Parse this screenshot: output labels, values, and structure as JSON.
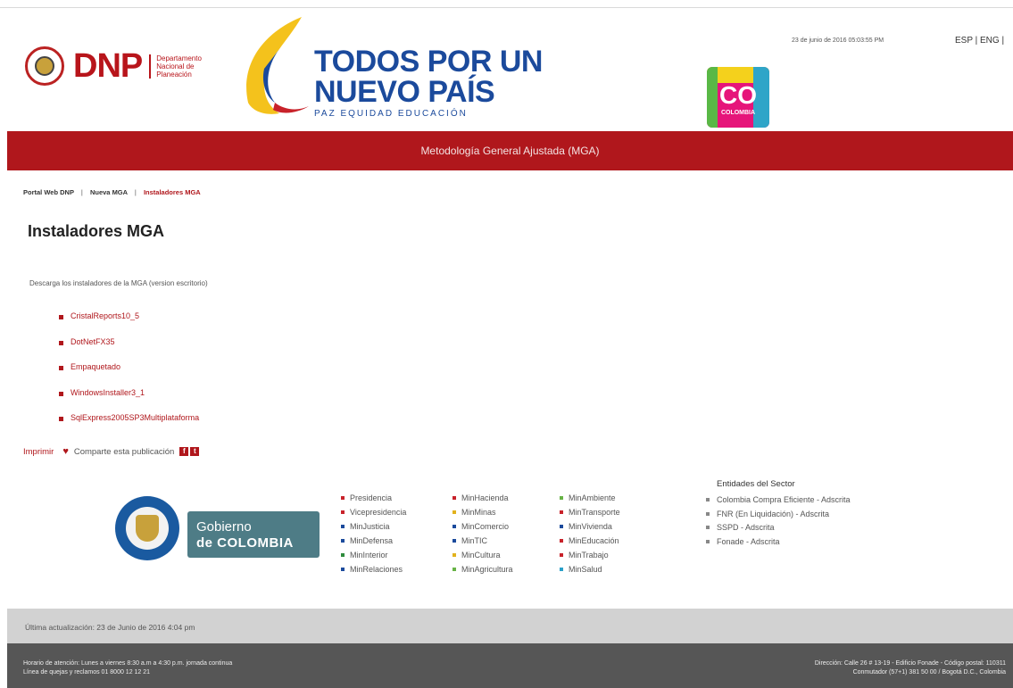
{
  "header": {
    "dnp_logo_text": "DNP",
    "dnp_logo_sub": "Departamento Nacional de Planeación",
    "slogan_line1": "TODOS POR UN",
    "slogan_line2": "NUEVO PAÍS",
    "slogan_line3": "PAZ  EQUIDAD  EDUCACIÓN",
    "colombia_logo_text": "CO",
    "colombia_logo_sub": "COLOMBIA",
    "date": "23 de junio de 2016 05:03:55 PM",
    "lang_esp": "ESP",
    "lang_sep": "|",
    "lang_eng": "ENG",
    "lang_trail": "|"
  },
  "banner": {
    "title": "Metodología General Ajustada (MGA)"
  },
  "breadcrumb": {
    "items": [
      "Portal Web DNP",
      "Nueva MGA",
      "Instaladores MGA"
    ],
    "separator": "|"
  },
  "page": {
    "title": "Instaladores MGA",
    "intro": "Descarga los instaladores de la MGA (version escritorio)",
    "downloads": [
      "CristalReports10_5",
      "DotNetFX35",
      "Empaquetado",
      "WindowsInstaller3_1",
      "SqlExpress2005SP3Multiplataforma"
    ]
  },
  "share": {
    "print_label": "Imprimir",
    "share_label": "Comparte esta publicación",
    "facebook": "f",
    "twitter": "t"
  },
  "gobierno": {
    "line1": "Gobierno",
    "line2": "de COLOMBIA"
  },
  "ministries": [
    {
      "label": "Presidencia",
      "color": "#c8222a"
    },
    {
      "label": "MinHacienda",
      "color": "#c8222a"
    },
    {
      "label": "MinAmbiente",
      "color": "#67b346"
    },
    {
      "label": "Vicepresidencia",
      "color": "#c8222a"
    },
    {
      "label": "MinMinas",
      "color": "#e2b21d"
    },
    {
      "label": "MinTransporte",
      "color": "#c8222a"
    },
    {
      "label": "MinJusticia",
      "color": "#1b4a9c"
    },
    {
      "label": "MinComercio",
      "color": "#1b4a9c"
    },
    {
      "label": "MinVivienda",
      "color": "#1b4a9c"
    },
    {
      "label": "MinDefensa",
      "color": "#1b4a9c"
    },
    {
      "label": "MinTIC",
      "color": "#1b4a9c"
    },
    {
      "label": "MinEducación",
      "color": "#c8222a"
    },
    {
      "label": "MinInterior",
      "color": "#2e8b3d"
    },
    {
      "label": "MinCultura",
      "color": "#e2b21d"
    },
    {
      "label": "MinTrabajo",
      "color": "#c8222a"
    },
    {
      "label": "MinRelaciones",
      "color": "#1b4a9c"
    },
    {
      "label": "MinAgricultura",
      "color": "#67b346"
    },
    {
      "label": "MinSalud",
      "color": "#2aa0c8"
    }
  ],
  "sector": {
    "title": "Entidades del Sector",
    "items": [
      "Colombia Compra Eficiente - Adscrita",
      "FNR (En Liquidación) - Adscrita",
      "SSPD - Adscrita",
      "Fonade - Adscrita"
    ]
  },
  "update": {
    "text": "Última actualización: 23 de Junio de 2016 4:04 pm"
  },
  "footer": {
    "left_line1": "Horario de atención: Lunes a viernes 8:30 a.m a 4:30 p.m. jornada continua",
    "left_line2": "Línea de quejas y reclamos 01 8000 12 12 21",
    "right_line1": "Dirección: Calle 26 # 13-19 - Edificio Fonade - Código postal: 110311",
    "right_line2": "Conmutador (57+1) 381 50 00 / Bogotá D.C., Colombia"
  }
}
